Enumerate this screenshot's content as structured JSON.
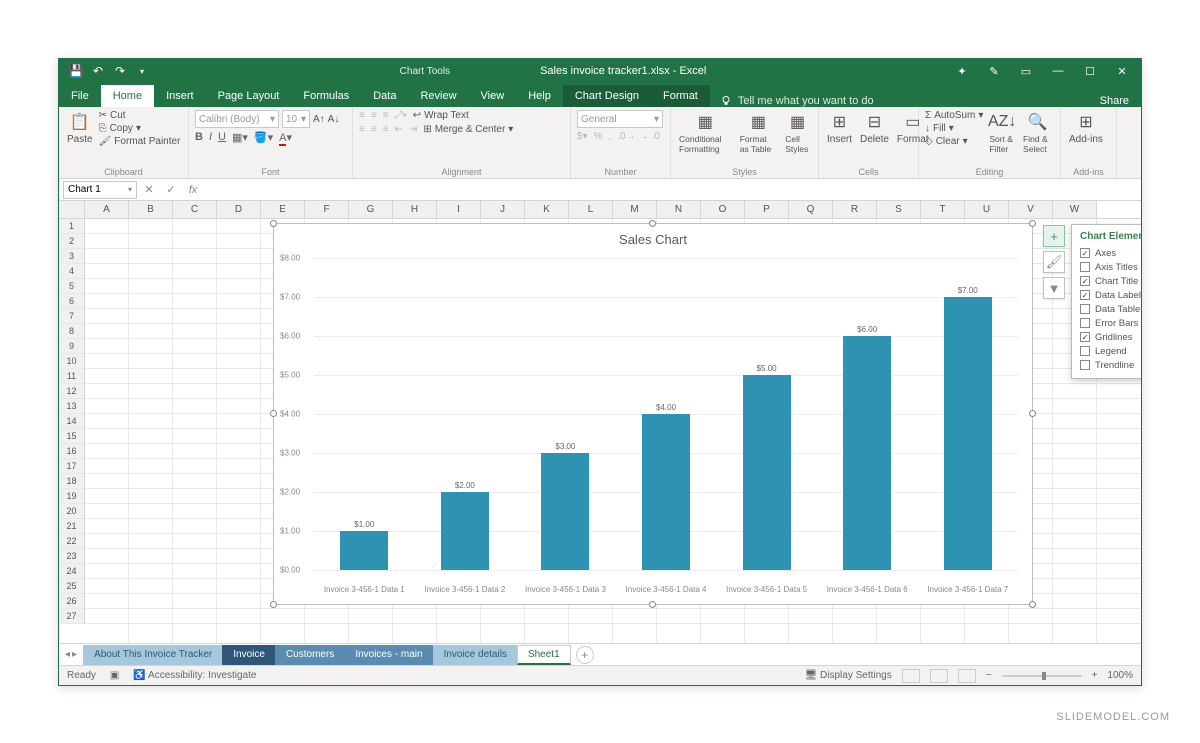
{
  "app": {
    "doc_title": "Sales invoice tracker1.xlsx - Excel",
    "chart_tools": "Chart Tools",
    "share": "Share"
  },
  "tabs": {
    "file": "File",
    "home": "Home",
    "insert": "Insert",
    "page_layout": "Page Layout",
    "formulas": "Formulas",
    "data": "Data",
    "review": "Review",
    "view": "View",
    "help": "Help",
    "chart_design": "Chart Design",
    "format": "Format",
    "tellme": "Tell me what you want to do"
  },
  "ribbon": {
    "clipboard": {
      "label": "Clipboard",
      "paste": "Paste",
      "cut": "Cut",
      "copy": "Copy",
      "format_painter": "Format Painter"
    },
    "font": {
      "label": "Font",
      "name": "Calibri (Body)",
      "size": "10"
    },
    "alignment": {
      "label": "Alignment",
      "wrap": "Wrap Text",
      "merge": "Merge & Center"
    },
    "number": {
      "label": "Number",
      "format": "General"
    },
    "styles": {
      "label": "Styles",
      "cond": "Conditional Formatting",
      "table": "Format as Table",
      "cell": "Cell Styles"
    },
    "cells": {
      "label": "Cells",
      "insert": "Insert",
      "delete": "Delete",
      "format": "Format"
    },
    "editing": {
      "label": "Editing",
      "autosum": "AutoSum",
      "fill": "Fill",
      "clear": "Clear",
      "sort": "Sort & Filter",
      "find": "Find & Select"
    },
    "addins": {
      "label": "Add-ins",
      "btn": "Add-ins"
    }
  },
  "formula_bar": {
    "name_box": "Chart 1",
    "fx": "fx"
  },
  "columns": [
    "A",
    "B",
    "C",
    "D",
    "E",
    "F",
    "G",
    "H",
    "I",
    "J",
    "K",
    "L",
    "M",
    "N",
    "O",
    "P",
    "Q",
    "R",
    "S",
    "T",
    "U",
    "V",
    "W"
  ],
  "row_count": 27,
  "chart_data": {
    "type": "bar",
    "title": "Sales Chart",
    "categories": [
      "Invoice 3-456-1 Data 1",
      "Invoice 3-456-1 Data 2",
      "Invoice 3-456-1 Data 3",
      "Invoice 3-456-1 Data 4",
      "Invoice 3-456-1 Data 5",
      "Invoice 3-456-1 Data 6",
      "Invoice 3-456-1 Data 7"
    ],
    "values": [
      1.0,
      2.0,
      3.0,
      4.0,
      5.0,
      6.0,
      7.0
    ],
    "data_labels": [
      "$1.00",
      "$2.00",
      "$3.00",
      "$4.00",
      "$5.00",
      "$6.00",
      "$7.00"
    ],
    "y_ticks": [
      "$0.00",
      "$1.00",
      "$2.00",
      "$3.00",
      "$4.00",
      "$5.00",
      "$6.00",
      "$7.00",
      "$8.00"
    ],
    "ylim": [
      0,
      8
    ],
    "xlabel": "",
    "ylabel": ""
  },
  "chart_elements": {
    "title": "Chart Elements",
    "items": [
      {
        "label": "Axes",
        "checked": true
      },
      {
        "label": "Axis Titles",
        "checked": false
      },
      {
        "label": "Chart Title",
        "checked": true
      },
      {
        "label": "Data Labels",
        "checked": true
      },
      {
        "label": "Data Table",
        "checked": false
      },
      {
        "label": "Error Bars",
        "checked": false
      },
      {
        "label": "Gridlines",
        "checked": true
      },
      {
        "label": "Legend",
        "checked": false
      },
      {
        "label": "Trendline",
        "checked": false
      }
    ]
  },
  "sheets": {
    "tabs": [
      {
        "label": "About This Invoice Tracker",
        "style": "light"
      },
      {
        "label": "Invoice",
        "style": "dark"
      },
      {
        "label": "Customers",
        "style": "med"
      },
      {
        "label": "Invoices - main",
        "style": "med"
      },
      {
        "label": "Invoice details",
        "style": "light"
      },
      {
        "label": "Sheet1",
        "style": "active"
      }
    ]
  },
  "status": {
    "ready": "Ready",
    "accessibility": "Accessibility: Investigate",
    "display_settings": "Display Settings",
    "zoom": "100%"
  },
  "watermark": "SLIDEMODEL.COM"
}
